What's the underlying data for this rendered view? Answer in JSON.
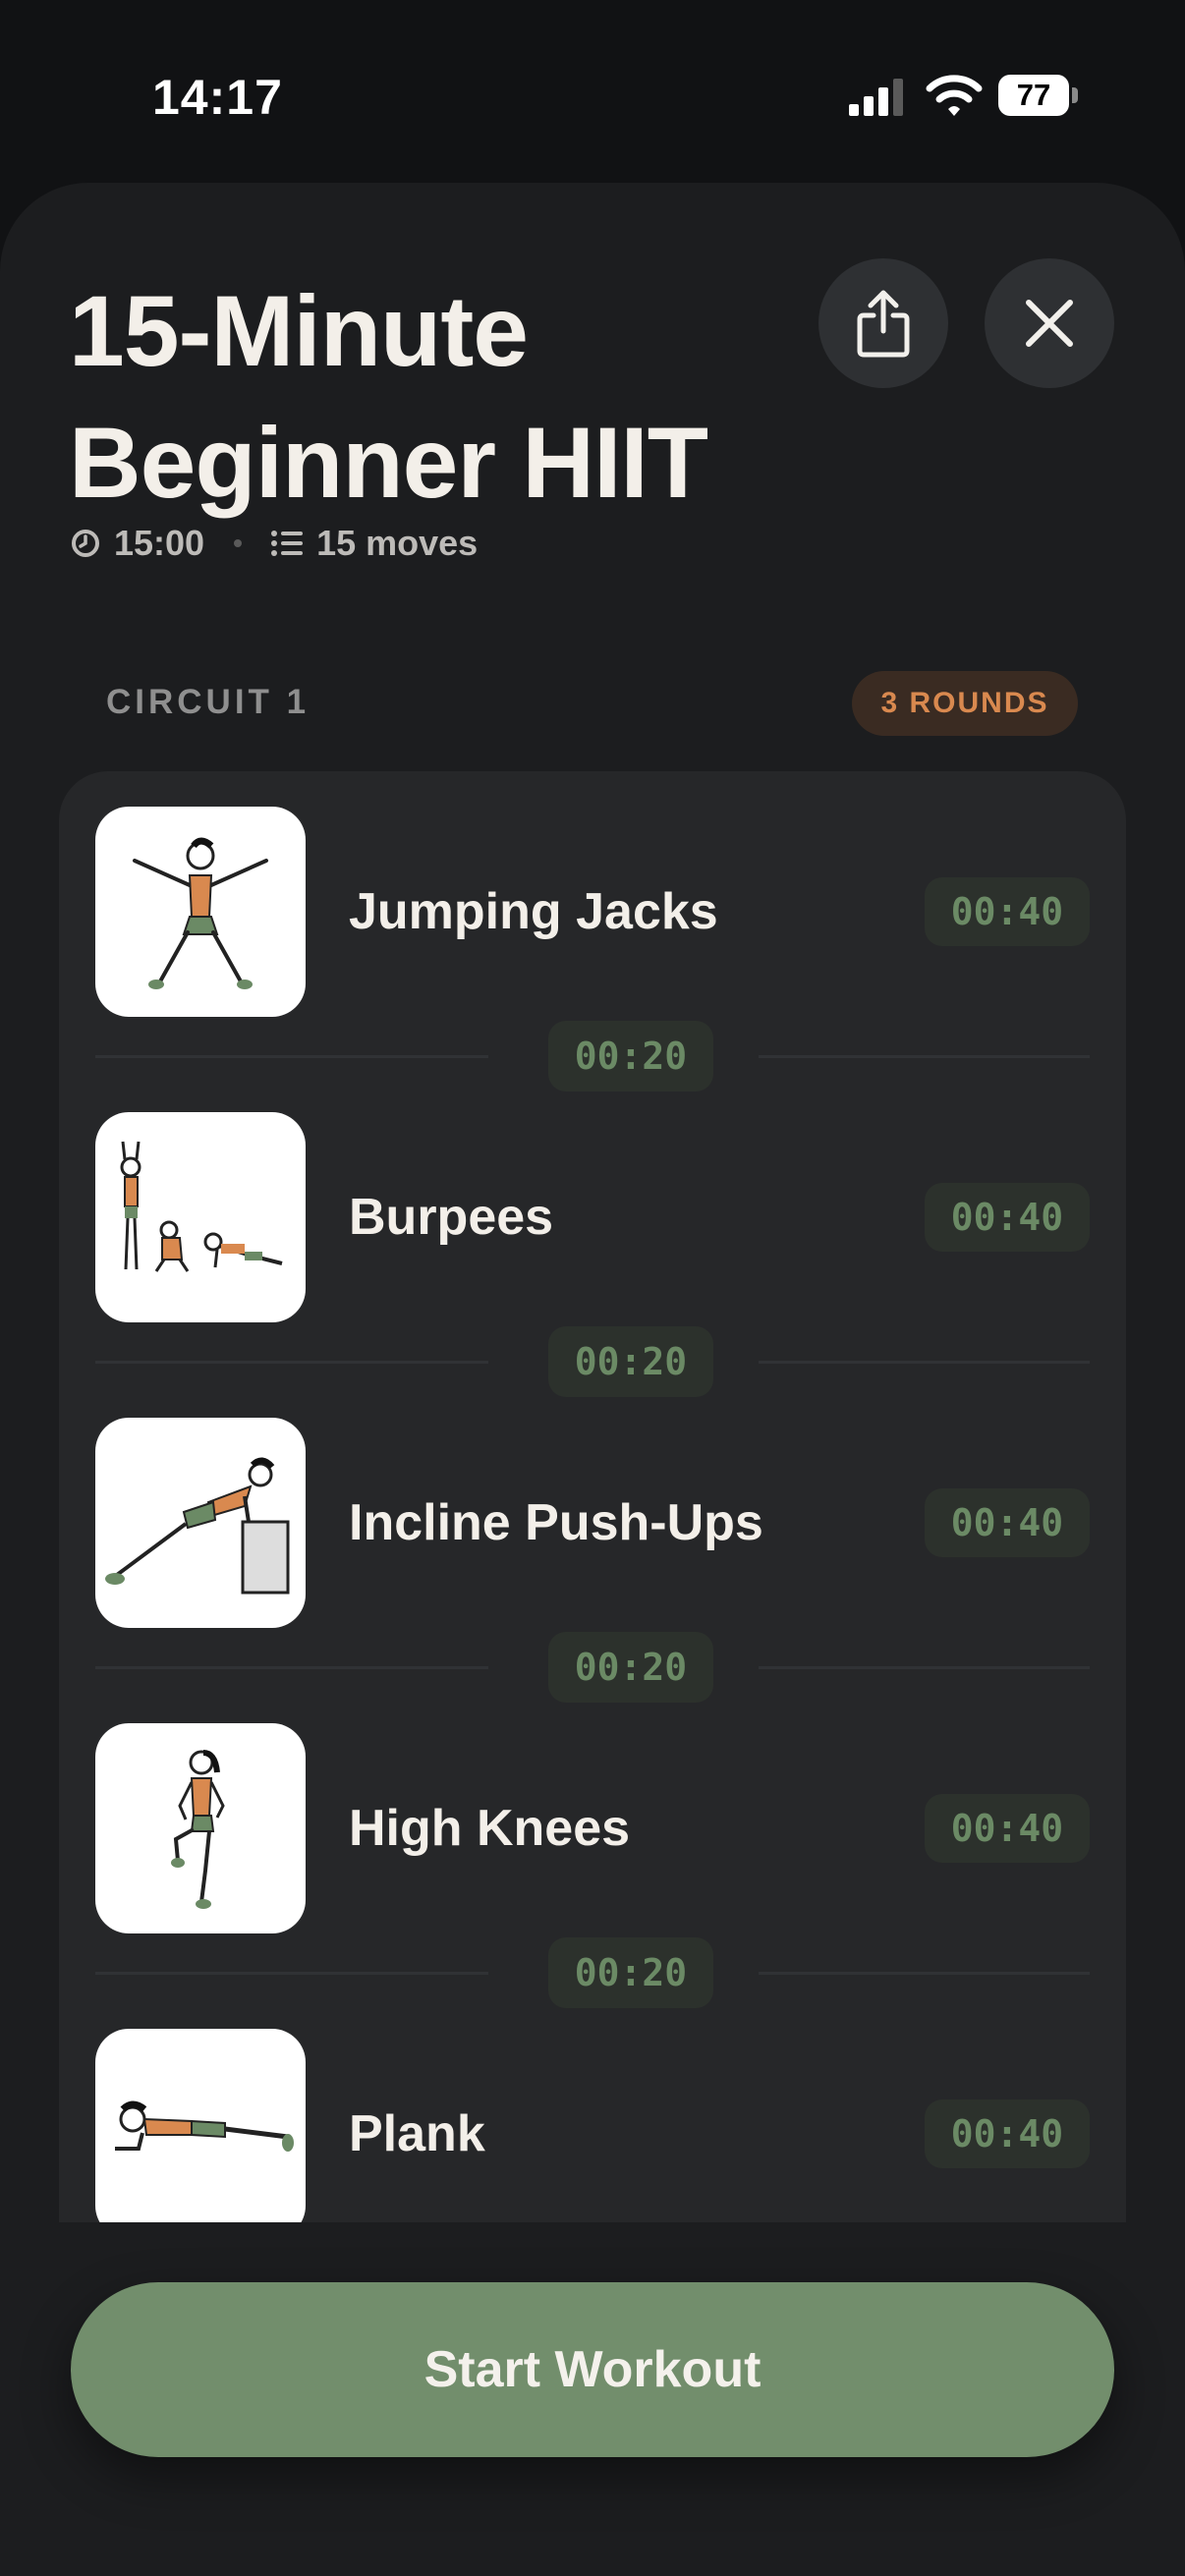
{
  "status": {
    "time": "14:17",
    "battery": "77",
    "icons": [
      "cellular-signal-icon",
      "wifi-icon",
      "battery-icon"
    ]
  },
  "workout": {
    "title": "15-Minute Beginner HIIT",
    "duration": "15:00",
    "moves": "15 moves"
  },
  "actions": {
    "share_icon": "share-icon",
    "close_icon": "close-icon"
  },
  "circuit": {
    "label": "CIRCUIT 1",
    "rounds": "3 ROUNDS",
    "exercises": [
      {
        "name": "Jumping Jacks",
        "time": "00:40",
        "rest": "00:20"
      },
      {
        "name": "Burpees",
        "time": "00:40",
        "rest": "00:20"
      },
      {
        "name": "Incline Push-Ups",
        "time": "00:40",
        "rest": "00:20"
      },
      {
        "name": "High Knees",
        "time": "00:40",
        "rest": "00:20"
      },
      {
        "name": "Plank",
        "time": "00:40"
      }
    ]
  },
  "cta": {
    "start_label": "Start Workout"
  },
  "colors": {
    "accent_green": "#728e6c",
    "timer_green": "#6b8a65",
    "rounds_orange": "#d9894f",
    "background": "#111214",
    "sheet": "#1c1d1f"
  }
}
